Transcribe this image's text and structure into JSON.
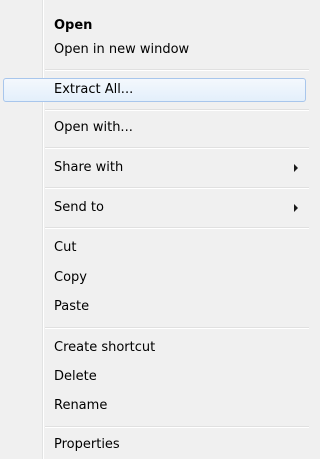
{
  "menu": {
    "items": [
      {
        "label": "Open",
        "bold": true
      },
      {
        "label": "Open in new window"
      },
      {
        "label": "Extract All..."
      },
      {
        "label": "Open with..."
      },
      {
        "label": "Share with",
        "submenu": true
      },
      {
        "label": "Send to",
        "submenu": true
      },
      {
        "label": "Cut"
      },
      {
        "label": "Copy"
      },
      {
        "label": "Paste"
      },
      {
        "label": "Create shortcut"
      },
      {
        "label": "Delete"
      },
      {
        "label": "Rename"
      },
      {
        "label": "Properties"
      }
    ],
    "highlighted_item": "Extract All...",
    "colors": {
      "background": "#f0f0f0",
      "highlight_border": "#a8c6ec",
      "highlight_fill": "#e3effb",
      "text": "#000000"
    }
  }
}
